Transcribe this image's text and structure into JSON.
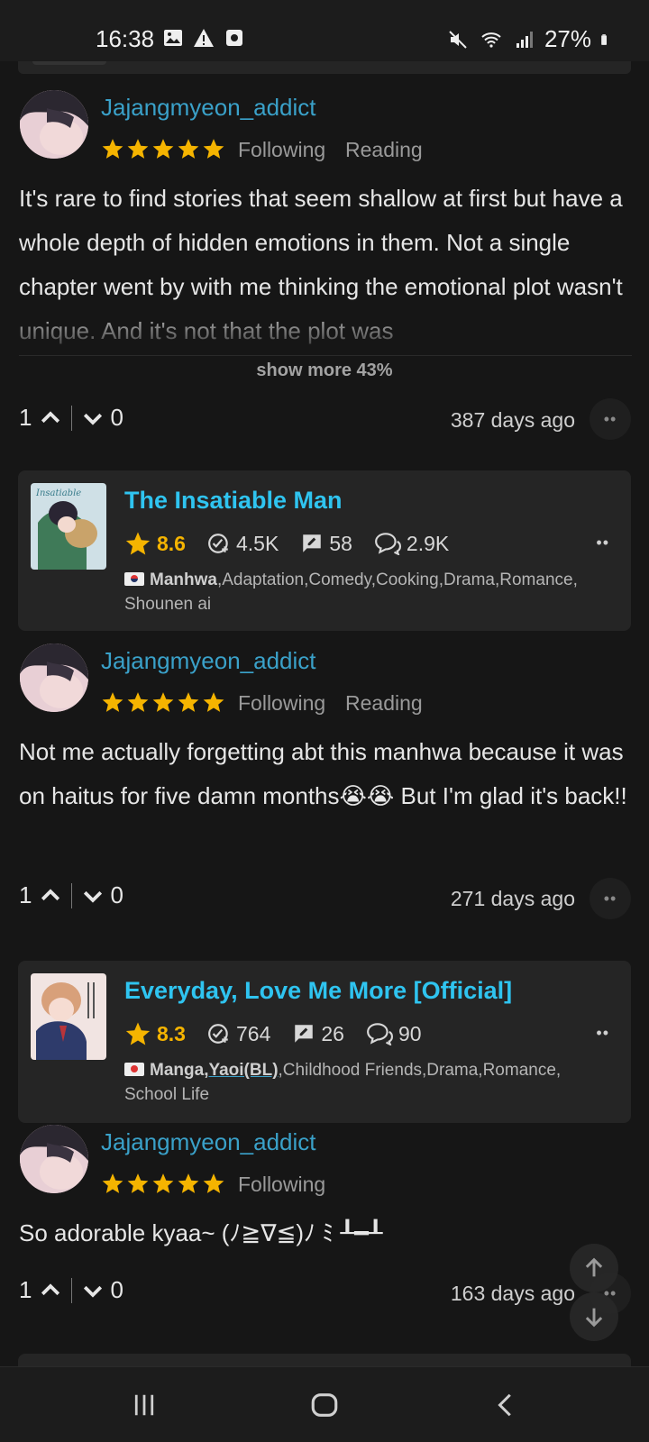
{
  "status_bar": {
    "time": "16:38",
    "battery": "27%",
    "icons_left": [
      "image-icon",
      "warning-icon",
      "record-icon"
    ],
    "icons_right": [
      "mute-icon",
      "wifi-icon",
      "signal-icon",
      "battery-icon"
    ]
  },
  "reviews": [
    {
      "username": "Jajangmyeon_addict",
      "stars": 5,
      "tags": [
        "Following",
        "Reading"
      ],
      "text": "It's rare to find stories that seem shallow at first but have a whole depth of hidden emotions in them. Not a single chapter went by with me thinking the emotional plot wasn't unique. And it's not that the plot was",
      "show_more": "show more 43%",
      "upvotes": "1",
      "downvotes": "0",
      "days_ago": "387 days ago"
    },
    {
      "username": "Jajangmyeon_addict",
      "stars": 5,
      "tags": [
        "Following",
        "Reading"
      ],
      "text": "Not me actually forgetting abt this manhwa because it was on haitus for five damn months😭😭 But I'm glad it's back!!",
      "upvotes": "1",
      "downvotes": "0",
      "days_ago": "271 days ago"
    },
    {
      "username": "Jajangmyeon_addict",
      "stars": 5,
      "tags": [
        "Following"
      ],
      "text": "So adorable kyaa~ (ﾉ≧∇≦)ﾉ ﾐ ┸━┸",
      "upvotes": "1",
      "downvotes": "0",
      "days_ago": "163 days ago"
    }
  ],
  "titles": [
    {
      "name": "The Insatiable Man",
      "rating": "8.6",
      "follows": "4.5K",
      "reviews": "58",
      "comments": "2.9K",
      "type": "Manhwa",
      "genres": ",Adaptation,Comedy,Cooking,Drama,Romance, Shounen ai"
    },
    {
      "name": "Everyday, Love Me More [Official]",
      "rating": "8.3",
      "follows": "764",
      "reviews": "26",
      "comments": "90",
      "type": "Manga",
      "highlight_genre": "Yaoi(BL)",
      "genres": ",Childhood Friends,Drama,Romance, School Life"
    }
  ],
  "colors": {
    "background": "#161616",
    "card": "#252525",
    "username": "#3aa1c9",
    "title": "#2fc4f0",
    "star": "#f5b400"
  }
}
